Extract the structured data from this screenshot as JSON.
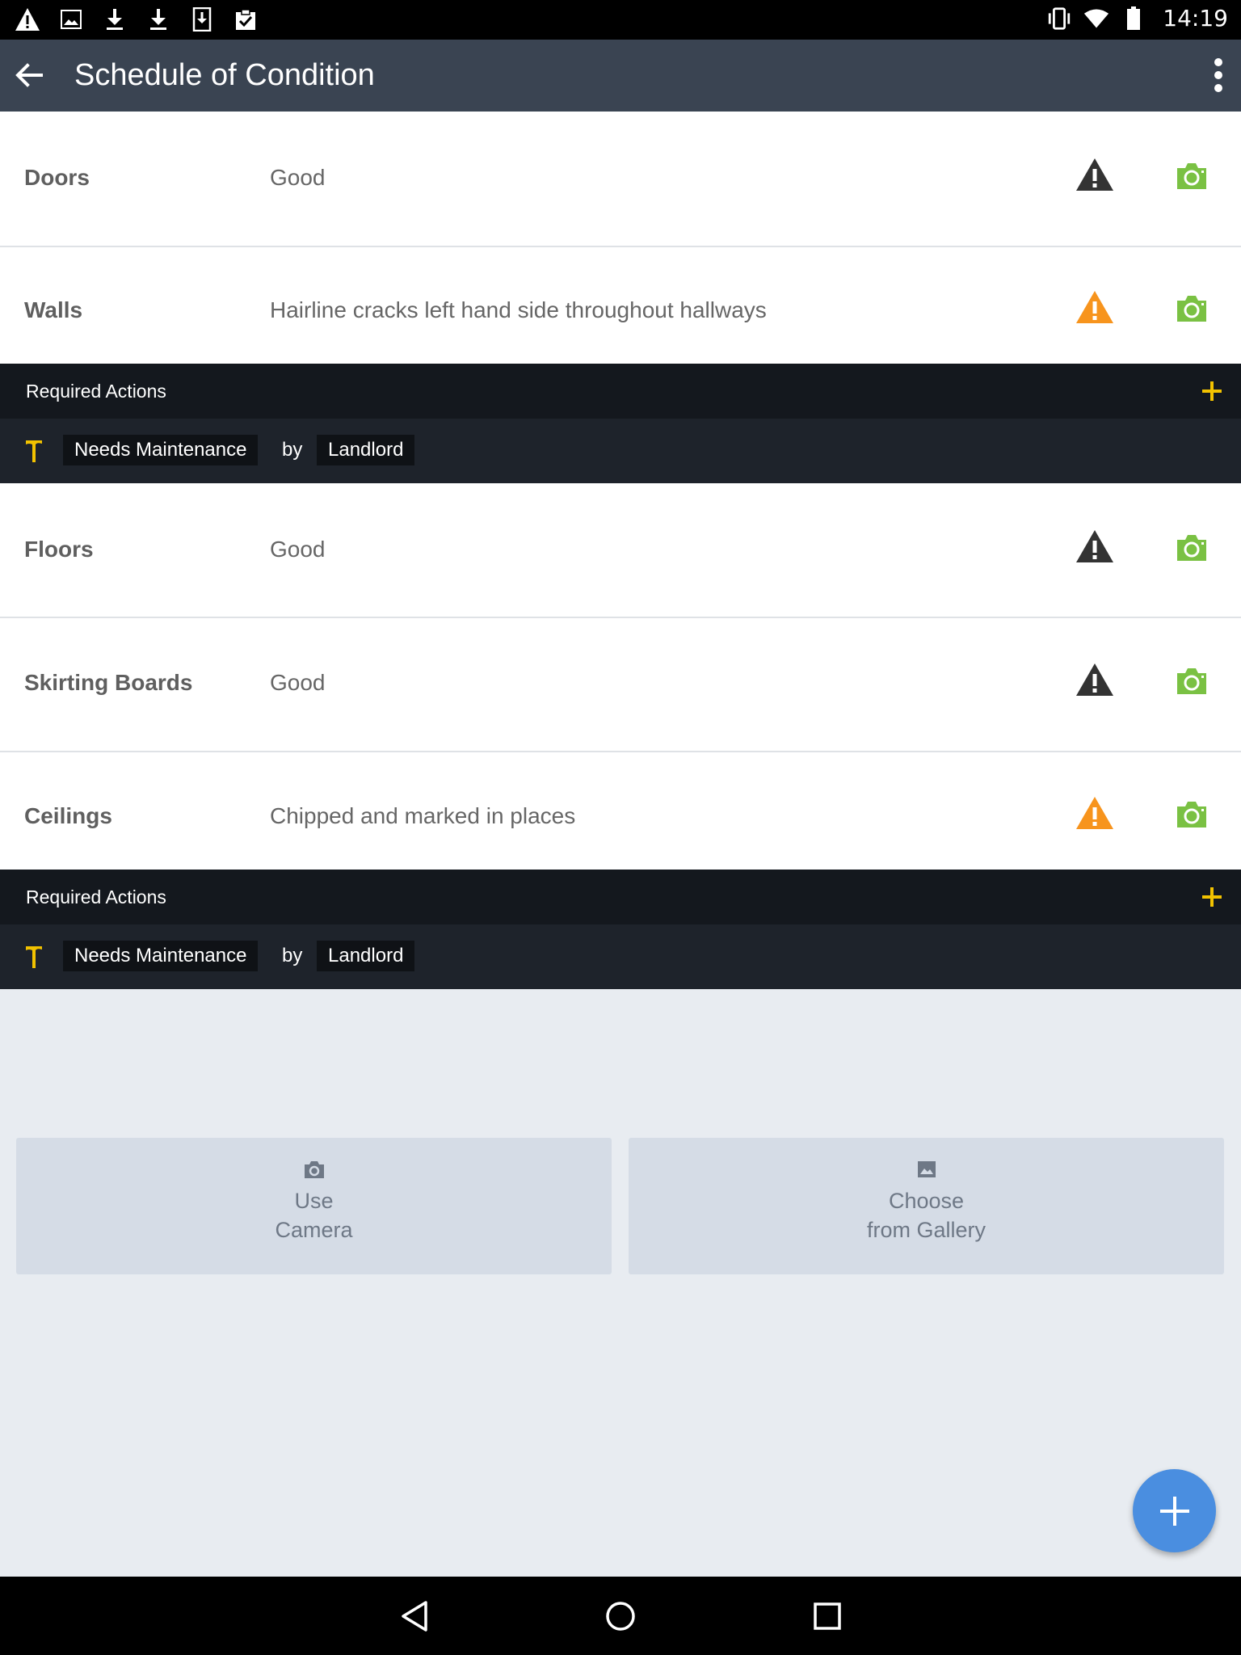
{
  "status_bar": {
    "time": "14:19",
    "left_icons": [
      "warning-icon",
      "image-icon",
      "download-icon",
      "download-icon",
      "download-box-icon",
      "clipboard-check-icon"
    ],
    "right_icons": [
      "vibrate-icon",
      "wifi-icon",
      "battery-icon"
    ]
  },
  "app_bar": {
    "title": "Schedule of Condition",
    "back_icon": "arrow-back-icon",
    "menu_icon": "more-vert-icon"
  },
  "items": [
    {
      "name": "Doors",
      "condition": "Good",
      "warning": "dark"
    },
    {
      "name": "Walls",
      "condition": "Hairline cracks left hand side throughout hallways",
      "warning": "orange"
    },
    {
      "name": "Floors",
      "condition": "Good",
      "warning": "dark"
    },
    {
      "name": "Skirting Boards",
      "condition": "Good",
      "warning": "dark"
    },
    {
      "name": "Ceilings",
      "condition": "Chipped and marked in places",
      "warning": "orange"
    }
  ],
  "required_actions": [
    {
      "header": "Required Actions",
      "action": "Needs Maintenance",
      "by": "by",
      "party": "Landlord"
    },
    {
      "header": "Required Actions",
      "action": "Needs Maintenance",
      "by": "by",
      "party": "Landlord"
    }
  ],
  "photo_buttons": {
    "camera": {
      "line1": "Use",
      "line2": "Camera"
    },
    "gallery": {
      "line1": "Choose",
      "line2": "from Gallery"
    }
  },
  "colors": {
    "app_bar": "#3a4452",
    "camera_green": "#7ac143",
    "warning_orange": "#f7941d",
    "warning_dark": "#333333",
    "accent_yellow": "#f2c200",
    "fab_blue": "#4a8ee0"
  }
}
